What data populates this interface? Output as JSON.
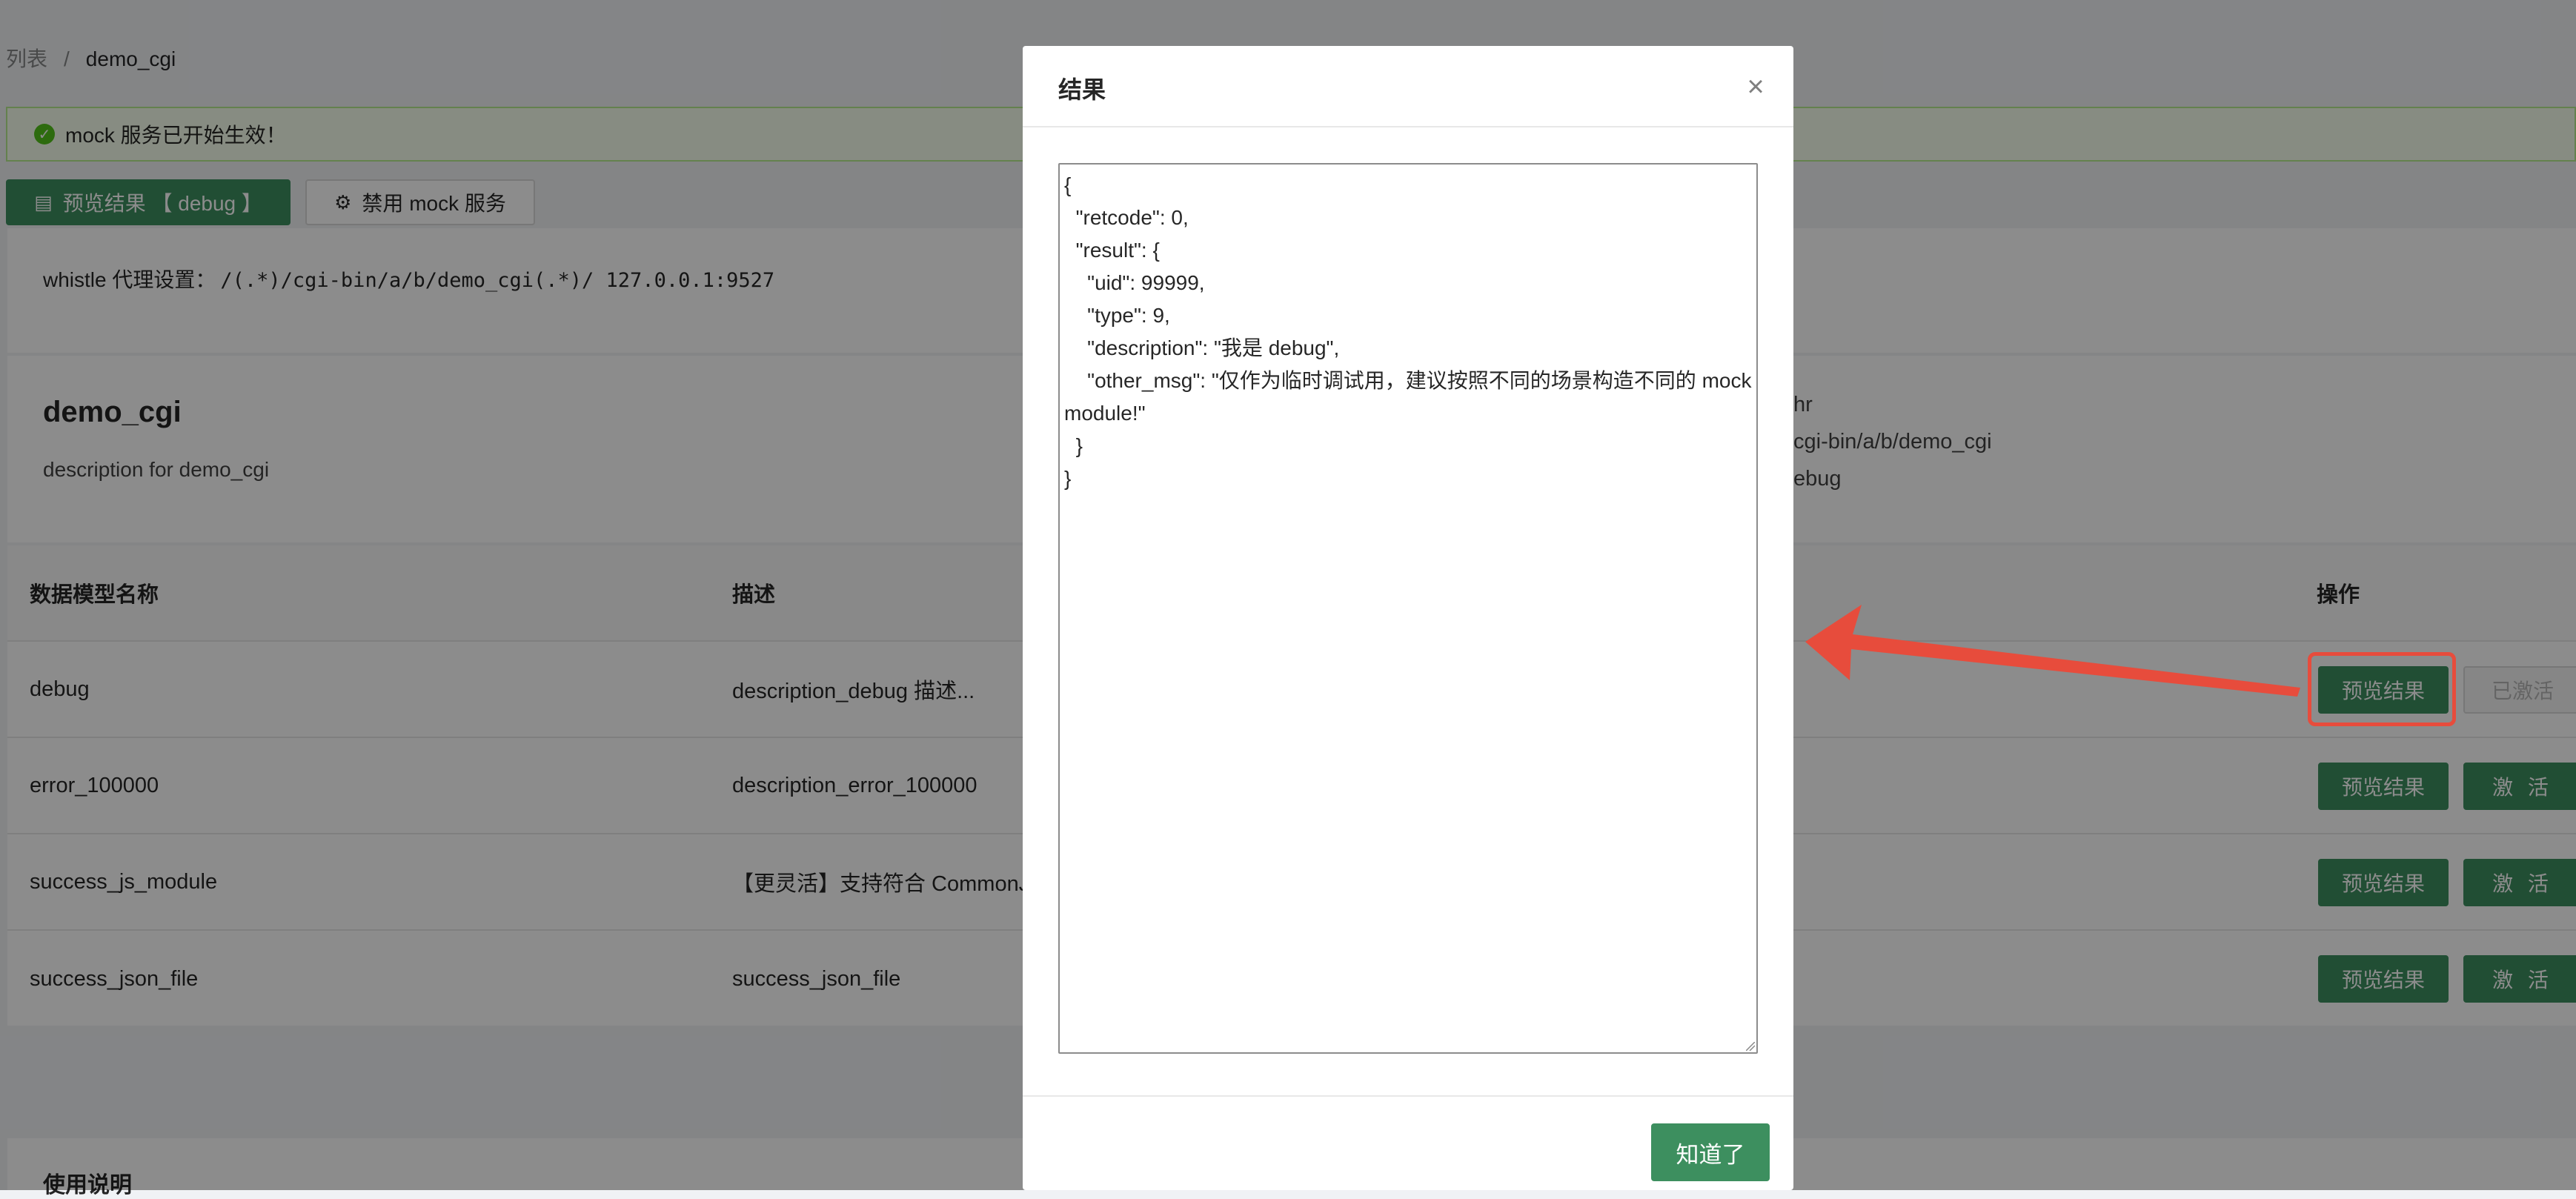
{
  "breadcrumb": {
    "items": [
      "列表",
      "demo_cgi"
    ],
    "separator": "/"
  },
  "alert": {
    "text": "mock 服务已开始生效！"
  },
  "toolbar": {
    "preview_label": "预览结果 【 debug 】",
    "disable_label": "禁用 mock 服务"
  },
  "proxy": {
    "label": "whistle 代理设置：",
    "rule": "/(.*)/cgi-bin/a/b/demo_cgi(.*)/ 127.0.0.1:9527"
  },
  "info": {
    "title": "demo_cgi",
    "description": "description for demo_cgi",
    "right_lines": [
      "hr",
      "cgi-bin/a/b/demo_cgi",
      "ebug"
    ]
  },
  "table": {
    "headers": {
      "name": "数据模型名称",
      "desc": "描述",
      "ops": "操作"
    },
    "rows": [
      {
        "name": "debug",
        "desc": "description_debug 描述...",
        "preview": "预览结果",
        "activate": "已激活",
        "active": true
      },
      {
        "name": "error_100000",
        "desc": "description_error_100000",
        "preview": "预览结果",
        "activate": "激 活",
        "active": false
      },
      {
        "name": "success_js_module",
        "desc": "【更灵活】支持符合 CommonJ",
        "preview": "预览结果",
        "activate": "激 活",
        "active": false
      },
      {
        "name": "success_json_file",
        "desc": "success_json_file",
        "preview": "预览结果",
        "activate": "激 活",
        "active": false
      }
    ]
  },
  "usage": {
    "title": "使用说明"
  },
  "modal": {
    "title": "结果",
    "content": "{\n  \"retcode\": 0,\n  \"result\": {\n    \"uid\": 99999,\n    \"type\": 9,\n    \"description\": \"我是 debug\",\n    \"other_msg\": \"仅作为临时调试用，建议按照不同的场景构造不同的 mock module!\"\n  }\n}",
    "ok_label": "知道了"
  },
  "colors": {
    "primary": "#3d8f5f",
    "annotation": "#e74c3c",
    "success": "#52c41a"
  }
}
